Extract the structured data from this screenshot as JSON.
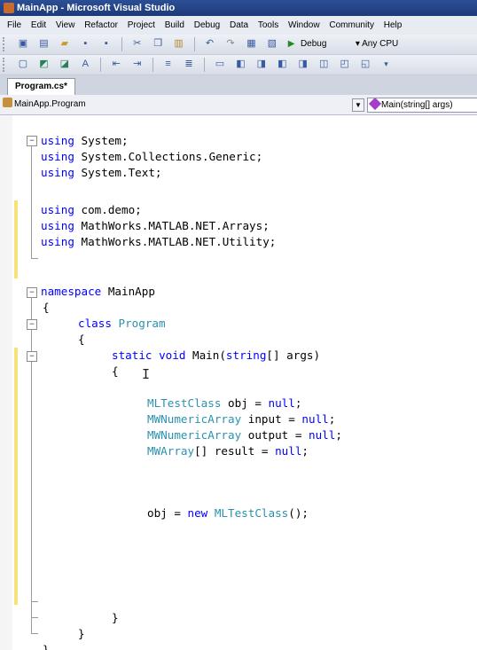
{
  "window": {
    "title": "MainApp - Microsoft Visual Studio"
  },
  "menu": [
    "File",
    "Edit",
    "View",
    "Refactor",
    "Project",
    "Build",
    "Debug",
    "Data",
    "Tools",
    "Window",
    "Community",
    "Help"
  ],
  "toolbar": {
    "configuration": "Debug",
    "platform": "Any CPU"
  },
  "tabs": {
    "active": "Program.cs*"
  },
  "navigation": {
    "type_selector": "MainApp.Program",
    "member_selector": "Main(string[] args)"
  },
  "code": {
    "l1": {
      "kw": "using",
      "rest": " System;"
    },
    "l2": {
      "kw": "using",
      "rest": " System.Collections.Generic;"
    },
    "l3": {
      "kw": "using",
      "rest": " System.Text;"
    },
    "l5": {
      "kw": "using",
      "rest": " com.demo;"
    },
    "l6": {
      "kw": "using",
      "rest": " MathWorks.MATLAB.NET.Arrays;"
    },
    "l7": {
      "kw": "using",
      "rest": " MathWorks.MATLAB.NET.Utility;"
    },
    "l10": {
      "kw": "namespace",
      "rest": " MainApp"
    },
    "l11": {
      "text": "{"
    },
    "l12": {
      "kw": "class",
      "ty": " Program"
    },
    "l13": {
      "text": "{"
    },
    "l14": {
      "kw": "static void",
      "rest": " Main(",
      "kw2": "string",
      "rest2": "[] args)"
    },
    "l15": {
      "text": "{"
    },
    "l17": {
      "ty": "MLTestClass",
      "rest": " obj = ",
      "kw": "null",
      "end": ";"
    },
    "l18": {
      "ty": "MWNumericArray",
      "rest": " input = ",
      "kw": "null",
      "end": ";"
    },
    "l19": {
      "ty": "MWNumericArray",
      "rest": " output = ",
      "kw": "null",
      "end": ";"
    },
    "l20": {
      "ty": "MWArray",
      "rest": "[] result = ",
      "kw": "null",
      "end": ";"
    },
    "l24": {
      "pre": "obj = ",
      "kw": "new",
      "ty": " MLTestClass",
      "end": "();"
    },
    "l31": {
      "text": "}"
    },
    "l32": {
      "text": "}"
    },
    "l33": {
      "text": "}"
    }
  }
}
